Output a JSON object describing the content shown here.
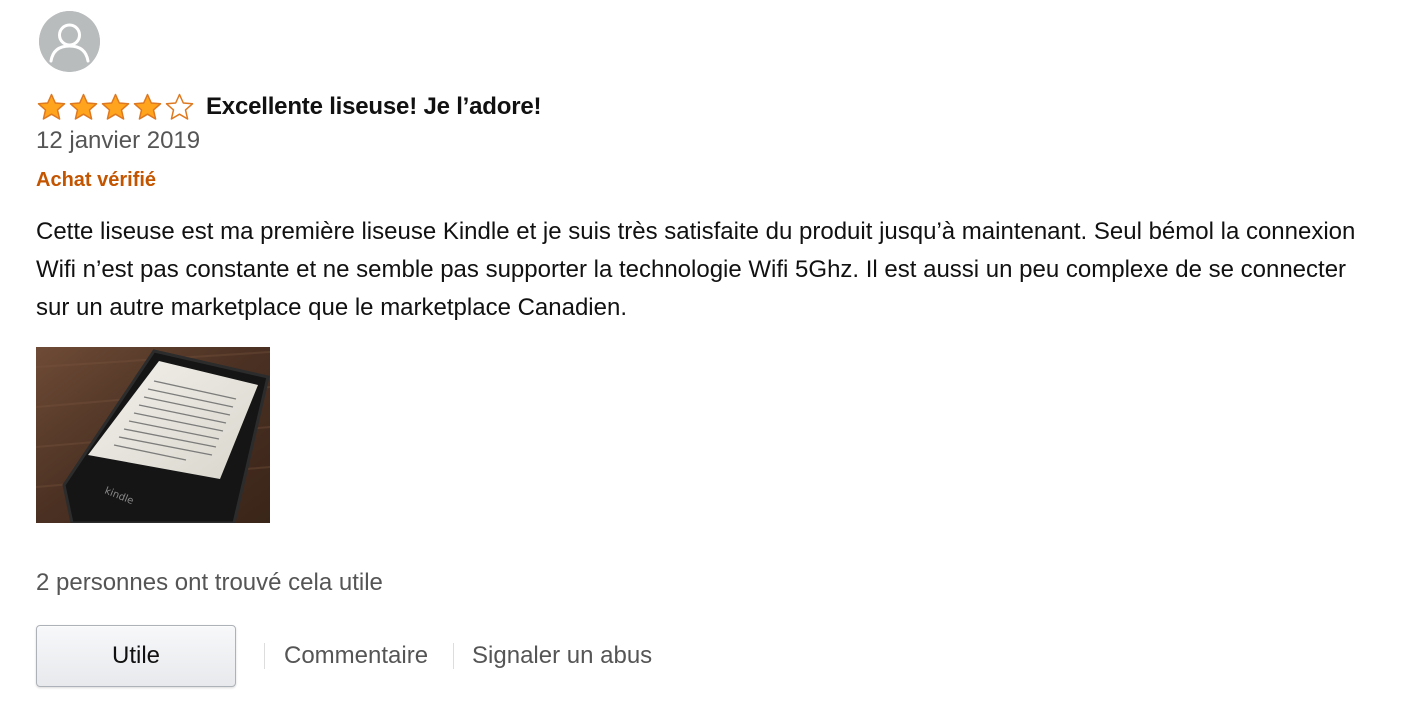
{
  "review": {
    "avatar_icon": "user-silhouette-icon",
    "rating": {
      "value": 4,
      "max": 5,
      "star_color": "#ffa41c",
      "star_outline": "#de7921"
    },
    "title": "Excellente liseuse! Je l’adore!",
    "date": "12 janvier 2019",
    "verified_label": "Achat vérifié",
    "body": "Cette liseuse est ma première liseuse Kindle et je suis très satisfaite du produit jusqu’à maintenant. Seul bémol la connexion Wifi n’est pas constante et ne semble pas supporter la technologie Wifi 5Ghz. Il est aussi un peu complexe de se connecter sur un autre marketplace que le marketplace Canadien.",
    "photo_device_label": "kindle",
    "helpful_count_text": "2 personnes ont trouvé cela utile"
  },
  "actions": {
    "helpful_button": "Utile",
    "comment_link": "Commentaire",
    "report_link": "Signaler un abus"
  },
  "colors": {
    "verified": "#c45500",
    "secondary_text": "#555555",
    "primary_text": "#111111"
  }
}
